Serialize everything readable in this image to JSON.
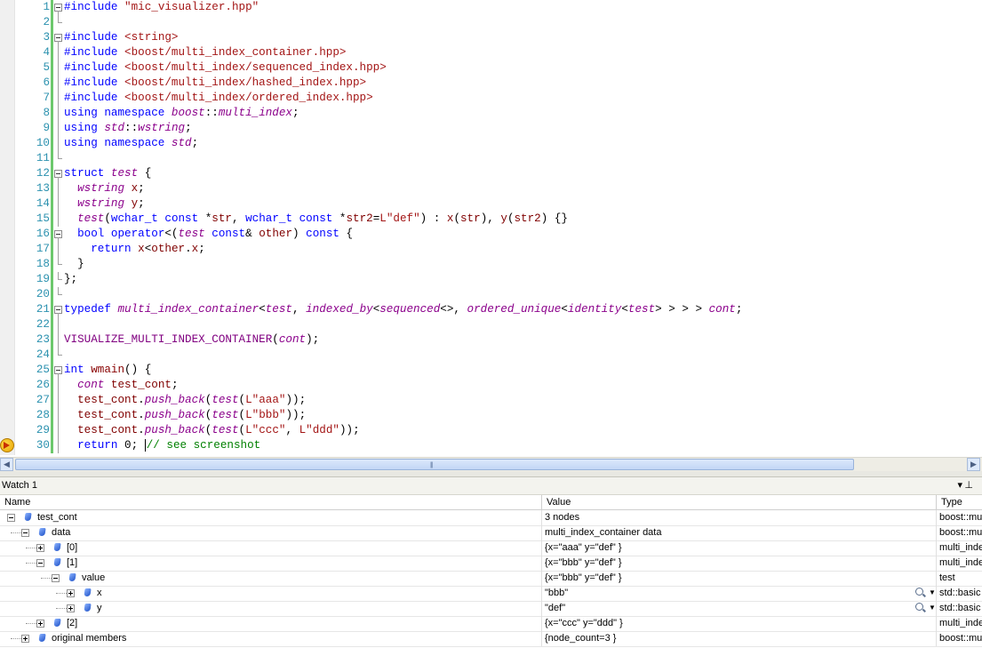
{
  "editor": {
    "lines": [
      {
        "n": "1",
        "tokens": [
          [
            "k",
            "#include "
          ],
          [
            "s",
            "\"mic_visualizer.hpp\""
          ]
        ]
      },
      {
        "n": "2",
        "tokens": []
      },
      {
        "n": "3",
        "tokens": [
          [
            "k",
            "#include "
          ],
          [
            "s",
            "<string>"
          ]
        ]
      },
      {
        "n": "4",
        "tokens": [
          [
            "k",
            "#include "
          ],
          [
            "s",
            "<boost/multi_index_container.hpp>"
          ]
        ]
      },
      {
        "n": "5",
        "tokens": [
          [
            "k",
            "#include "
          ],
          [
            "s",
            "<boost/multi_index/sequenced_index.hpp>"
          ]
        ]
      },
      {
        "n": "6",
        "tokens": [
          [
            "k",
            "#include "
          ],
          [
            "s",
            "<boost/multi_index/hashed_index.hpp>"
          ]
        ]
      },
      {
        "n": "7",
        "tokens": [
          [
            "k",
            "#include "
          ],
          [
            "s",
            "<boost/multi_index/ordered_index.hpp>"
          ]
        ]
      },
      {
        "n": "8",
        "tokens": [
          [
            "k",
            "using namespace "
          ],
          [
            "t",
            "boost"
          ],
          [
            "p",
            "::"
          ],
          [
            "t",
            "multi_index"
          ],
          [
            "p",
            ";"
          ]
        ]
      },
      {
        "n": "9",
        "tokens": [
          [
            "k",
            "using "
          ],
          [
            "t",
            "std"
          ],
          [
            "p",
            "::"
          ],
          [
            "t",
            "wstring"
          ],
          [
            "p",
            ";"
          ]
        ]
      },
      {
        "n": "10",
        "tokens": [
          [
            "k",
            "using namespace "
          ],
          [
            "t",
            "std"
          ],
          [
            "p",
            ";"
          ]
        ]
      },
      {
        "n": "11",
        "tokens": []
      },
      {
        "n": "12",
        "tokens": [
          [
            "k",
            "struct "
          ],
          [
            "t",
            "test"
          ],
          [
            "p",
            " {"
          ]
        ]
      },
      {
        "n": "13",
        "tokens": [
          [
            "p",
            "  "
          ],
          [
            "t",
            "wstring"
          ],
          [
            "v",
            " x"
          ],
          [
            "p",
            ";"
          ]
        ]
      },
      {
        "n": "14",
        "tokens": [
          [
            "p",
            "  "
          ],
          [
            "t",
            "wstring"
          ],
          [
            "v",
            " y"
          ],
          [
            "p",
            ";"
          ]
        ]
      },
      {
        "n": "15",
        "tokens": [
          [
            "p",
            "  "
          ],
          [
            "t",
            "test"
          ],
          [
            "p",
            "("
          ],
          [
            "k",
            "wchar_t const "
          ],
          [
            "p",
            "*"
          ],
          [
            "v",
            "str"
          ],
          [
            "p",
            ", "
          ],
          [
            "k",
            "wchar_t const "
          ],
          [
            "p",
            "*"
          ],
          [
            "v",
            "str2"
          ],
          [
            "p",
            "="
          ],
          [
            "s",
            "L\"def\""
          ],
          [
            "p",
            ") : "
          ],
          [
            "v",
            "x"
          ],
          [
            "p",
            "("
          ],
          [
            "v",
            "str"
          ],
          [
            "p",
            "), "
          ],
          [
            "v",
            "y"
          ],
          [
            "p",
            "("
          ],
          [
            "v",
            "str2"
          ],
          [
            "p",
            ") {}"
          ]
        ]
      },
      {
        "n": "16",
        "tokens": [
          [
            "p",
            "  "
          ],
          [
            "k",
            "bool operator"
          ],
          [
            "p",
            "<("
          ],
          [
            "t",
            "test"
          ],
          [
            "k",
            " const"
          ],
          [
            "p",
            "& "
          ],
          [
            "v",
            "other"
          ],
          [
            "p",
            ") "
          ],
          [
            "k",
            "const"
          ],
          [
            "p",
            " {"
          ]
        ]
      },
      {
        "n": "17",
        "tokens": [
          [
            "p",
            "    "
          ],
          [
            "k",
            "return "
          ],
          [
            "v",
            "x"
          ],
          [
            "p",
            "<"
          ],
          [
            "v",
            "other"
          ],
          [
            "p",
            "."
          ],
          [
            "v",
            "x"
          ],
          [
            "p",
            ";"
          ]
        ]
      },
      {
        "n": "18",
        "tokens": [
          [
            "p",
            "  }"
          ]
        ]
      },
      {
        "n": "19",
        "tokens": [
          [
            "p",
            "};"
          ]
        ]
      },
      {
        "n": "20",
        "tokens": []
      },
      {
        "n": "21",
        "tokens": [
          [
            "k",
            "typedef "
          ],
          [
            "t",
            "multi_index_container"
          ],
          [
            "p",
            "<"
          ],
          [
            "t",
            "test"
          ],
          [
            "p",
            ", "
          ],
          [
            "t",
            "indexed_by"
          ],
          [
            "p",
            "<"
          ],
          [
            "t",
            "sequenced"
          ],
          [
            "p",
            "<>, "
          ],
          [
            "t",
            "ordered_unique"
          ],
          [
            "p",
            "<"
          ],
          [
            "t",
            "identity"
          ],
          [
            "p",
            "<"
          ],
          [
            "t",
            "test"
          ],
          [
            "p",
            "> > > > "
          ],
          [
            "t",
            "cont"
          ],
          [
            "p",
            ";"
          ]
        ]
      },
      {
        "n": "22",
        "tokens": []
      },
      {
        "n": "23",
        "tokens": [
          [
            "m",
            "VISUALIZE_MULTI_INDEX_CONTAINER"
          ],
          [
            "p",
            "("
          ],
          [
            "t",
            "cont"
          ],
          [
            "p",
            ");"
          ]
        ]
      },
      {
        "n": "24",
        "tokens": []
      },
      {
        "n": "25",
        "tokens": [
          [
            "k",
            "int "
          ],
          [
            "fn",
            "wmain"
          ],
          [
            "p",
            "() {"
          ]
        ]
      },
      {
        "n": "26",
        "tokens": [
          [
            "p",
            "  "
          ],
          [
            "t",
            "cont"
          ],
          [
            "v",
            " test_cont"
          ],
          [
            "p",
            ";"
          ]
        ]
      },
      {
        "n": "27",
        "tokens": [
          [
            "p",
            "  "
          ],
          [
            "v",
            "test_cont"
          ],
          [
            "p",
            "."
          ],
          [
            "t",
            "push_back"
          ],
          [
            "p",
            "("
          ],
          [
            "t",
            "test"
          ],
          [
            "p",
            "("
          ],
          [
            "s",
            "L\"aaa\""
          ],
          [
            "p",
            "));"
          ]
        ]
      },
      {
        "n": "28",
        "tokens": [
          [
            "p",
            "  "
          ],
          [
            "v",
            "test_cont"
          ],
          [
            "p",
            "."
          ],
          [
            "t",
            "push_back"
          ],
          [
            "p",
            "("
          ],
          [
            "t",
            "test"
          ],
          [
            "p",
            "("
          ],
          [
            "s",
            "L\"bbb\""
          ],
          [
            "p",
            "));"
          ]
        ]
      },
      {
        "n": "29",
        "tokens": [
          [
            "p",
            "  "
          ],
          [
            "v",
            "test_cont"
          ],
          [
            "p",
            "."
          ],
          [
            "t",
            "push_back"
          ],
          [
            "p",
            "("
          ],
          [
            "t",
            "test"
          ],
          [
            "p",
            "("
          ],
          [
            "s",
            "L\"ccc\""
          ],
          [
            "p",
            ", "
          ],
          [
            "s",
            "L\"ddd\""
          ],
          [
            "p",
            "));"
          ]
        ]
      },
      {
        "n": "30",
        "tokens": [
          [
            "p",
            "  "
          ],
          [
            "k",
            "return "
          ],
          [
            "p",
            "0; "
          ],
          [
            "caret",
            ""
          ],
          [
            "c",
            "// see screenshot"
          ]
        ]
      }
    ]
  },
  "watch": {
    "title": "Watch 1",
    "columns": {
      "name": "Name",
      "value": "Value",
      "type": "Type"
    },
    "rows": [
      {
        "name": "test_cont",
        "value": "3 nodes",
        "type": "boost::mu"
      },
      {
        "name": "data",
        "value": "multi_index_container data",
        "type": "boost::mu"
      },
      {
        "name": "[0]",
        "value": "{x=\"aaa\" y=\"def\" }",
        "type": "multi_inde"
      },
      {
        "name": "[1]",
        "value": "{x=\"bbb\" y=\"def\" }",
        "type": "multi_inde"
      },
      {
        "name": "value",
        "value": "{x=\"bbb\" y=\"def\" }",
        "type": "test"
      },
      {
        "name": "x",
        "value": "\"bbb\"",
        "type": "std::basic"
      },
      {
        "name": "y",
        "value": "\"def\"",
        "type": "std::basic"
      },
      {
        "name": "[2]",
        "value": "{x=\"ccc\" y=\"ddd\" }",
        "type": "multi_inde"
      },
      {
        "name": "original members",
        "value": "{node_count=3 }",
        "type": "boost::mu"
      }
    ]
  }
}
